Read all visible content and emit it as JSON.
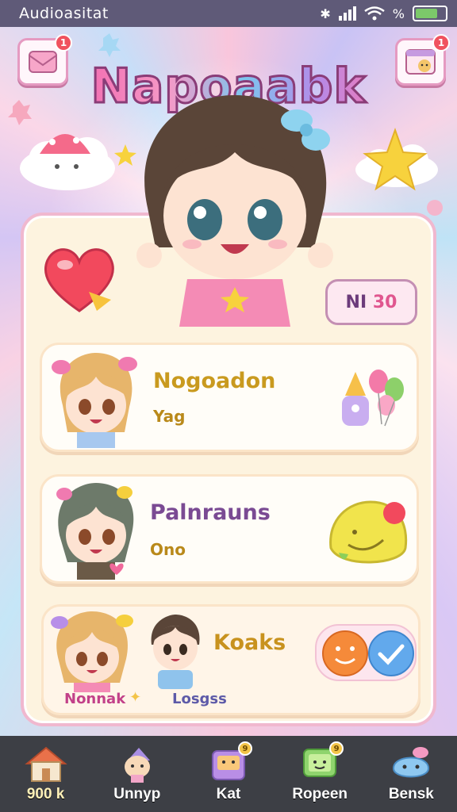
{
  "status_bar": {
    "title": "Audioasitat",
    "battery_level": 0.75
  },
  "header": {
    "app_title": "Napoaabk",
    "left_button_badge": "1",
    "right_button_badge": "1",
    "left_button_icon": "message-card-icon",
    "right_button_icon": "calendar-avatar-icon"
  },
  "score": {
    "prefix": "NI",
    "value": "30"
  },
  "cards": [
    {
      "title": "Nogoadon",
      "subtitle": "Yag",
      "title_color": "#c99a1f",
      "icon": "balloons-icon"
    },
    {
      "title": "Palnrauns",
      "subtitle": "Ono",
      "title_color": "#7a4a93",
      "icon": "slime-icon"
    },
    {
      "title": "Koaks",
      "label_left": "Nonnak",
      "label_right": "Losgss",
      "title_color": "#c8921e",
      "actions": [
        "smile-button-icon",
        "check-button-icon"
      ]
    }
  ],
  "nav": [
    {
      "label": "900 k",
      "icon": "home-icon",
      "badge": ""
    },
    {
      "label": "Unnyp",
      "icon": "character-icon",
      "badge": ""
    },
    {
      "label": "Kat",
      "icon": "inbox-icon",
      "badge": "9"
    },
    {
      "label": "Ropeen",
      "icon": "tv-icon",
      "badge": "9"
    },
    {
      "label": "Bensk",
      "icon": "friend-icon",
      "badge": ""
    }
  ],
  "colors": {
    "accent_pink": "#f0b8cf",
    "nav_bg": "#3d3f45",
    "badge_red": "#f0525e"
  }
}
